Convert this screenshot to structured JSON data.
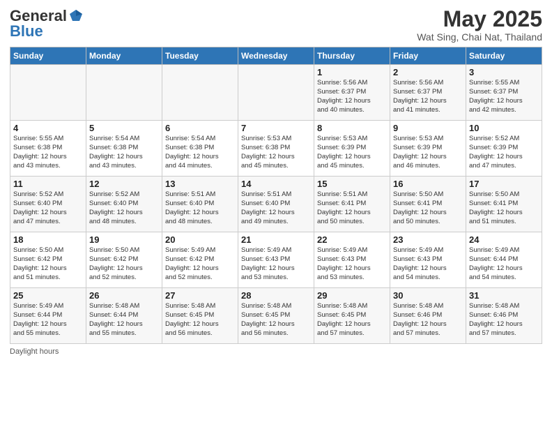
{
  "header": {
    "logo_general": "General",
    "logo_blue": "Blue",
    "title": "May 2025",
    "subtitle": "Wat Sing, Chai Nat, Thailand"
  },
  "days_of_week": [
    "Sunday",
    "Monday",
    "Tuesday",
    "Wednesday",
    "Thursday",
    "Friday",
    "Saturday"
  ],
  "weeks": [
    [
      {
        "day": "",
        "info": ""
      },
      {
        "day": "",
        "info": ""
      },
      {
        "day": "",
        "info": ""
      },
      {
        "day": "",
        "info": ""
      },
      {
        "day": "1",
        "info": "Sunrise: 5:56 AM\nSunset: 6:37 PM\nDaylight: 12 hours\nand 40 minutes."
      },
      {
        "day": "2",
        "info": "Sunrise: 5:56 AM\nSunset: 6:37 PM\nDaylight: 12 hours\nand 41 minutes."
      },
      {
        "day": "3",
        "info": "Sunrise: 5:55 AM\nSunset: 6:37 PM\nDaylight: 12 hours\nand 42 minutes."
      }
    ],
    [
      {
        "day": "4",
        "info": "Sunrise: 5:55 AM\nSunset: 6:38 PM\nDaylight: 12 hours\nand 43 minutes."
      },
      {
        "day": "5",
        "info": "Sunrise: 5:54 AM\nSunset: 6:38 PM\nDaylight: 12 hours\nand 43 minutes."
      },
      {
        "day": "6",
        "info": "Sunrise: 5:54 AM\nSunset: 6:38 PM\nDaylight: 12 hours\nand 44 minutes."
      },
      {
        "day": "7",
        "info": "Sunrise: 5:53 AM\nSunset: 6:38 PM\nDaylight: 12 hours\nand 45 minutes."
      },
      {
        "day": "8",
        "info": "Sunrise: 5:53 AM\nSunset: 6:39 PM\nDaylight: 12 hours\nand 45 minutes."
      },
      {
        "day": "9",
        "info": "Sunrise: 5:53 AM\nSunset: 6:39 PM\nDaylight: 12 hours\nand 46 minutes."
      },
      {
        "day": "10",
        "info": "Sunrise: 5:52 AM\nSunset: 6:39 PM\nDaylight: 12 hours\nand 47 minutes."
      }
    ],
    [
      {
        "day": "11",
        "info": "Sunrise: 5:52 AM\nSunset: 6:40 PM\nDaylight: 12 hours\nand 47 minutes."
      },
      {
        "day": "12",
        "info": "Sunrise: 5:52 AM\nSunset: 6:40 PM\nDaylight: 12 hours\nand 48 minutes."
      },
      {
        "day": "13",
        "info": "Sunrise: 5:51 AM\nSunset: 6:40 PM\nDaylight: 12 hours\nand 48 minutes."
      },
      {
        "day": "14",
        "info": "Sunrise: 5:51 AM\nSunset: 6:40 PM\nDaylight: 12 hours\nand 49 minutes."
      },
      {
        "day": "15",
        "info": "Sunrise: 5:51 AM\nSunset: 6:41 PM\nDaylight: 12 hours\nand 50 minutes."
      },
      {
        "day": "16",
        "info": "Sunrise: 5:50 AM\nSunset: 6:41 PM\nDaylight: 12 hours\nand 50 minutes."
      },
      {
        "day": "17",
        "info": "Sunrise: 5:50 AM\nSunset: 6:41 PM\nDaylight: 12 hours\nand 51 minutes."
      }
    ],
    [
      {
        "day": "18",
        "info": "Sunrise: 5:50 AM\nSunset: 6:42 PM\nDaylight: 12 hours\nand 51 minutes."
      },
      {
        "day": "19",
        "info": "Sunrise: 5:50 AM\nSunset: 6:42 PM\nDaylight: 12 hours\nand 52 minutes."
      },
      {
        "day": "20",
        "info": "Sunrise: 5:49 AM\nSunset: 6:42 PM\nDaylight: 12 hours\nand 52 minutes."
      },
      {
        "day": "21",
        "info": "Sunrise: 5:49 AM\nSunset: 6:43 PM\nDaylight: 12 hours\nand 53 minutes."
      },
      {
        "day": "22",
        "info": "Sunrise: 5:49 AM\nSunset: 6:43 PM\nDaylight: 12 hours\nand 53 minutes."
      },
      {
        "day": "23",
        "info": "Sunrise: 5:49 AM\nSunset: 6:43 PM\nDaylight: 12 hours\nand 54 minutes."
      },
      {
        "day": "24",
        "info": "Sunrise: 5:49 AM\nSunset: 6:44 PM\nDaylight: 12 hours\nand 54 minutes."
      }
    ],
    [
      {
        "day": "25",
        "info": "Sunrise: 5:49 AM\nSunset: 6:44 PM\nDaylight: 12 hours\nand 55 minutes."
      },
      {
        "day": "26",
        "info": "Sunrise: 5:48 AM\nSunset: 6:44 PM\nDaylight: 12 hours\nand 55 minutes."
      },
      {
        "day": "27",
        "info": "Sunrise: 5:48 AM\nSunset: 6:45 PM\nDaylight: 12 hours\nand 56 minutes."
      },
      {
        "day": "28",
        "info": "Sunrise: 5:48 AM\nSunset: 6:45 PM\nDaylight: 12 hours\nand 56 minutes."
      },
      {
        "day": "29",
        "info": "Sunrise: 5:48 AM\nSunset: 6:45 PM\nDaylight: 12 hours\nand 57 minutes."
      },
      {
        "day": "30",
        "info": "Sunrise: 5:48 AM\nSunset: 6:46 PM\nDaylight: 12 hours\nand 57 minutes."
      },
      {
        "day": "31",
        "info": "Sunrise: 5:48 AM\nSunset: 6:46 PM\nDaylight: 12 hours\nand 57 minutes."
      }
    ]
  ],
  "footer": {
    "daylight_label": "Daylight hours"
  }
}
